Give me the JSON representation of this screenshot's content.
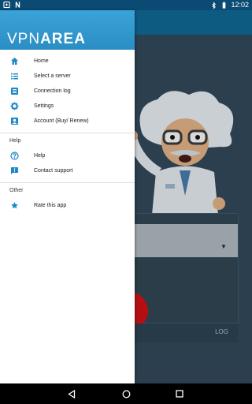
{
  "status_bar": {
    "time": "12:02",
    "left_icons": [
      "notification-icon",
      "n-notification-icon"
    ],
    "right_icons": [
      "bluetooth-icon",
      "battery-icon"
    ]
  },
  "drawer": {
    "brand_part1": "VPN",
    "brand_part2": "AREA",
    "items": [
      {
        "label": "Home",
        "icon": "home-icon"
      },
      {
        "label": "Select a server",
        "icon": "list-icon"
      },
      {
        "label": "Connection log",
        "icon": "log-icon"
      },
      {
        "label": "Settings",
        "icon": "gear-icon"
      },
      {
        "label": "Account (Buy/ Renew)",
        "icon": "account-icon"
      }
    ],
    "help_section": {
      "title": "Help",
      "items": [
        {
          "label": "Help",
          "icon": "help-icon"
        },
        {
          "label": "Contact support",
          "icon": "support-icon"
        }
      ]
    },
    "other_section": {
      "title": "Other",
      "items": [
        {
          "label": "Rate this app",
          "icon": "star-icon"
        }
      ]
    }
  },
  "background": {
    "log_label": "LOG"
  },
  "colors": {
    "accent": "#1e88c8",
    "header": "#3ba3d8",
    "toolbar": "#0e5b82",
    "status_bar": "#0b4a73"
  }
}
